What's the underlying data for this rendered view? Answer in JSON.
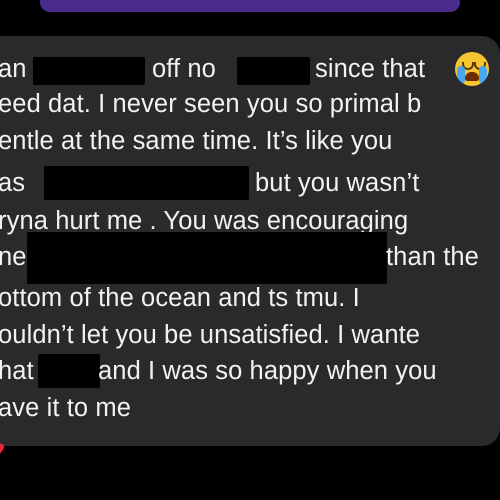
{
  "message": {
    "lines": [
      {
        "segments": [
          "an s",
          "off no",
          "since that"
        ]
      },
      {
        "segments": [
          "eed dat. I never seen you so primal b"
        ]
      },
      {
        "segments": [
          "entle at the same time. It’s like you"
        ]
      },
      {
        "segments": [
          "as",
          "but you wasn’t"
        ]
      },
      {
        "segments": [
          "ryna hurt me . You was encouraging"
        ]
      },
      {
        "segments": [
          "ne",
          "than the"
        ]
      },
      {
        "segments": [
          "ottom of the ocean and ts tmu. I"
        ]
      },
      {
        "segments": [
          "ouldn’t let you be unsatisfied. I wante"
        ]
      },
      {
        "segments": [
          "hat",
          "and I was so happy when you"
        ]
      },
      {
        "segments": [
          "ave it to me"
        ]
      }
    ],
    "emoji": "loudly-crying-face-icon"
  },
  "reaction": {
    "icon": "red-heart-icon"
  },
  "colors": {
    "background": "#000000",
    "bubble": "#2a2a2c",
    "text": "#f2f2f2",
    "header": "#4a2a8a",
    "heart": "#e8243a"
  }
}
